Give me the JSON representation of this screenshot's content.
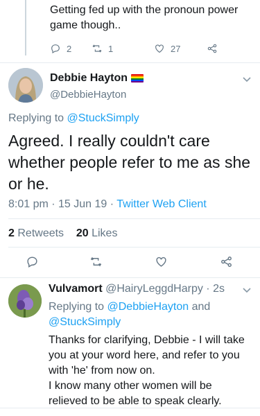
{
  "previous_tweet": {
    "text": "Getting fed up with the pronoun power game though..",
    "replies": "2",
    "retweets": "1",
    "likes": "27"
  },
  "main_tweet": {
    "display_name": "Debbie Hayton",
    "handle": "@DebbieHayton",
    "replying_prefix": "Replying to ",
    "replying_to": "@StuckSimply",
    "text": "Agreed. I really couldn't care whether people refer to me as she or he.",
    "timestamp": "8:01 pm · 15 Jun 19 · ",
    "client": "Twitter Web Client",
    "retweets_count": "2",
    "retweets_label": "Retweets",
    "likes_count": "20",
    "likes_label": "Likes"
  },
  "reply_tweet": {
    "display_name": "Vulvamort",
    "handle_time": "@HairyLeggdHarpy · 2s",
    "replying_prefix": "Replying to ",
    "replying_to_1": "@DebbieHayton",
    "replying_and": " and ",
    "replying_to_2": "@StuckSimply",
    "text_1": "Thanks for clarifying, Debbie - I will take you at your word here, and refer to you with 'he' from now on.",
    "text_2": "I know many other women will be relieved to be able to speak clearly."
  },
  "colors": {
    "accent": "#1da1f2",
    "secondary_text": "#657786",
    "primary_text": "#14171a",
    "divider": "#e6ecf0"
  },
  "icons": [
    "reply-icon",
    "retweet-icon",
    "like-icon",
    "share-icon",
    "chevron-down-icon",
    "rainbow-flag-icon"
  ]
}
